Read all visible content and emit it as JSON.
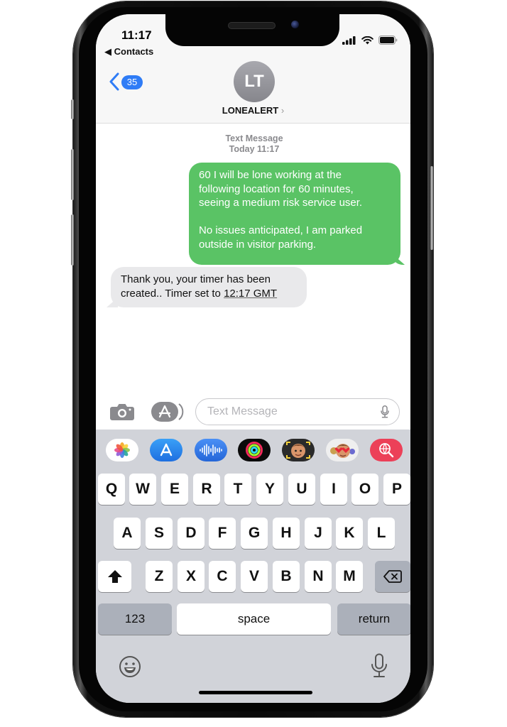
{
  "status_bar": {
    "time": "11:17",
    "back_app": "◀ Contacts"
  },
  "header": {
    "back_badge": "35",
    "avatar_initials": "LT",
    "contact_name": "LONEALERT",
    "contact_chevron": "›"
  },
  "conversation": {
    "meta_line1": "Text Message",
    "meta_line2": "Today 11:17",
    "messages": [
      {
        "direction": "outgoing",
        "lines": [
          "60 I will be lone working at the",
          "following location for 60 minutes,",
          "seeing a medium risk service user.",
          "",
          "No issues anticipated, I am parked",
          "outside in visitor parking."
        ]
      },
      {
        "direction": "incoming",
        "line1": "Thank you, your timer has been",
        "line2_prefix": "created.. Timer set to ",
        "line2_link": "12:17 GMT"
      }
    ]
  },
  "composer": {
    "placeholder": "Text Message",
    "value": ""
  },
  "app_strip": [
    {
      "name": "photos-app-icon"
    },
    {
      "name": "app-store-icon"
    },
    {
      "name": "audio-message-icon"
    },
    {
      "name": "activity-rings-icon"
    },
    {
      "name": "memoji-camera-icon"
    },
    {
      "name": "memoji-stickers-icon"
    },
    {
      "name": "web-images-search-icon"
    }
  ],
  "keyboard": {
    "row1": [
      "Q",
      "W",
      "E",
      "R",
      "T",
      "Y",
      "U",
      "I",
      "O",
      "P"
    ],
    "row2": [
      "A",
      "S",
      "D",
      "F",
      "G",
      "H",
      "J",
      "K",
      "L"
    ],
    "row3": [
      "Z",
      "X",
      "C",
      "V",
      "B",
      "N",
      "M"
    ],
    "numbers_label": "123",
    "space_label": "space",
    "return_label": "return"
  },
  "colors": {
    "imessage_blue": "#2f7cf6",
    "sms_green": "#5ac365",
    "incoming_gray": "#e9e9eb",
    "keyboard_bg": "#d1d3d9"
  }
}
